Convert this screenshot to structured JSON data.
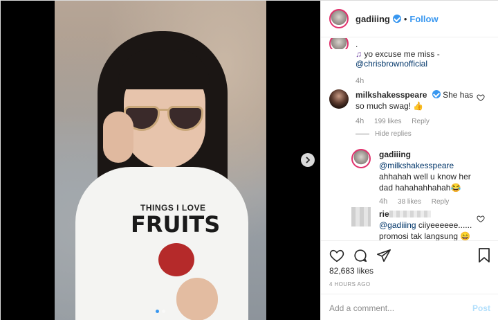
{
  "post": {
    "username": "gadiiing",
    "separator": "•",
    "follow_label": "Follow"
  },
  "caption": {
    "dot": ".",
    "line1": "yo excuse me miss -",
    "mention": "@chrisbrownofficial",
    "time": "4h"
  },
  "comments": [
    {
      "username": "milkshakesspeare",
      "text": "She has so much swag! 👍",
      "time": "4h",
      "likes": "199 likes",
      "reply": "Reply",
      "hide_replies": "Hide replies"
    },
    {
      "username": "gadiiing",
      "mention": "@milkshakesspeare",
      "text": "ahhahah well u know her dad hahahahhahah😂",
      "time": "4h",
      "likes": "38 likes",
      "reply": "Reply"
    },
    {
      "username_visible": "rie",
      "mention": "@gadiiing",
      "text": " ciiyeeeeee......",
      "text2": "promosi tak langsung 😄"
    }
  ],
  "photo": {
    "shirt_line1": "THINGS I LOVE",
    "shirt_line2": "FRUITS"
  },
  "footer": {
    "likes": "82,683 likes",
    "ago": "4 HOURS AGO",
    "add_comment_placeholder": "Add a comment...",
    "post_label": "Post"
  },
  "icons": {
    "heart": "heart-icon",
    "comment": "comment-icon",
    "share": "share-icon",
    "bookmark": "bookmark-icon",
    "next": "chevron-right-icon"
  },
  "colors": {
    "accent": "#3897f0",
    "link": "#003569",
    "muted": "#8e8e8e",
    "post_disabled": "#b2dffc"
  }
}
